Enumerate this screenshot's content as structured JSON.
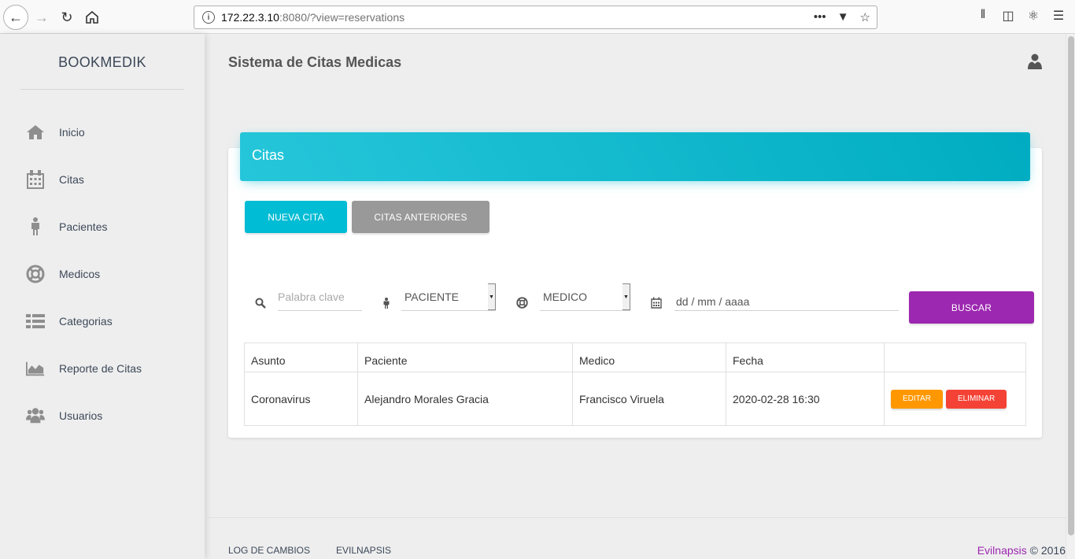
{
  "browser": {
    "url_host": "172.22.3.10",
    "url_rest": ":8080/?view=reservations",
    "more_glyph": "•••"
  },
  "sidebar": {
    "brand": "BOOKMEDIK",
    "items": [
      {
        "label": "Inicio",
        "icon": "home-icon"
      },
      {
        "label": "Citas",
        "icon": "calendar-icon"
      },
      {
        "label": "Pacientes",
        "icon": "person-icon"
      },
      {
        "label": "Medicos",
        "icon": "lifebuoy-icon"
      },
      {
        "label": "Categorias",
        "icon": "list-icon"
      },
      {
        "label": "Reporte de Citas",
        "icon": "area-chart-icon"
      },
      {
        "label": "Usuarios",
        "icon": "users-icon"
      }
    ]
  },
  "header": {
    "title": "Sistema de Citas Medicas"
  },
  "card": {
    "title": "Citas",
    "new_button": "NUEVA CITA",
    "previous_button": "CITAS ANTERIORES"
  },
  "filters": {
    "keyword_placeholder": "Palabra clave",
    "patient_select": "PACIENTE",
    "doctor_select": "MEDICO",
    "date_placeholder": "dd / mm / aaaa",
    "search_button": "BUSCAR"
  },
  "table": {
    "headers": [
      "Asunto",
      "Paciente",
      "Medico",
      "Fecha",
      ""
    ],
    "rows": [
      {
        "subject": "Coronavirus",
        "patient": "Alejandro Morales Gracia",
        "doctor": "Francisco Viruela",
        "date": "2020-02-28 16:30",
        "edit_label": "EDITAR",
        "delete_label": "ELIMINAR"
      }
    ]
  },
  "footer": {
    "changelog": "LOG DE CAMBIOS",
    "evilnapsis_link": "EVILNAPSIS",
    "copy_brand": "Evilnapsis",
    "copy_text": " © 2016"
  },
  "colors": {
    "accent_cyan": "#00bcd4",
    "accent_purple": "#9c27b0",
    "edit_orange": "#ff9800",
    "delete_red": "#f44336"
  }
}
